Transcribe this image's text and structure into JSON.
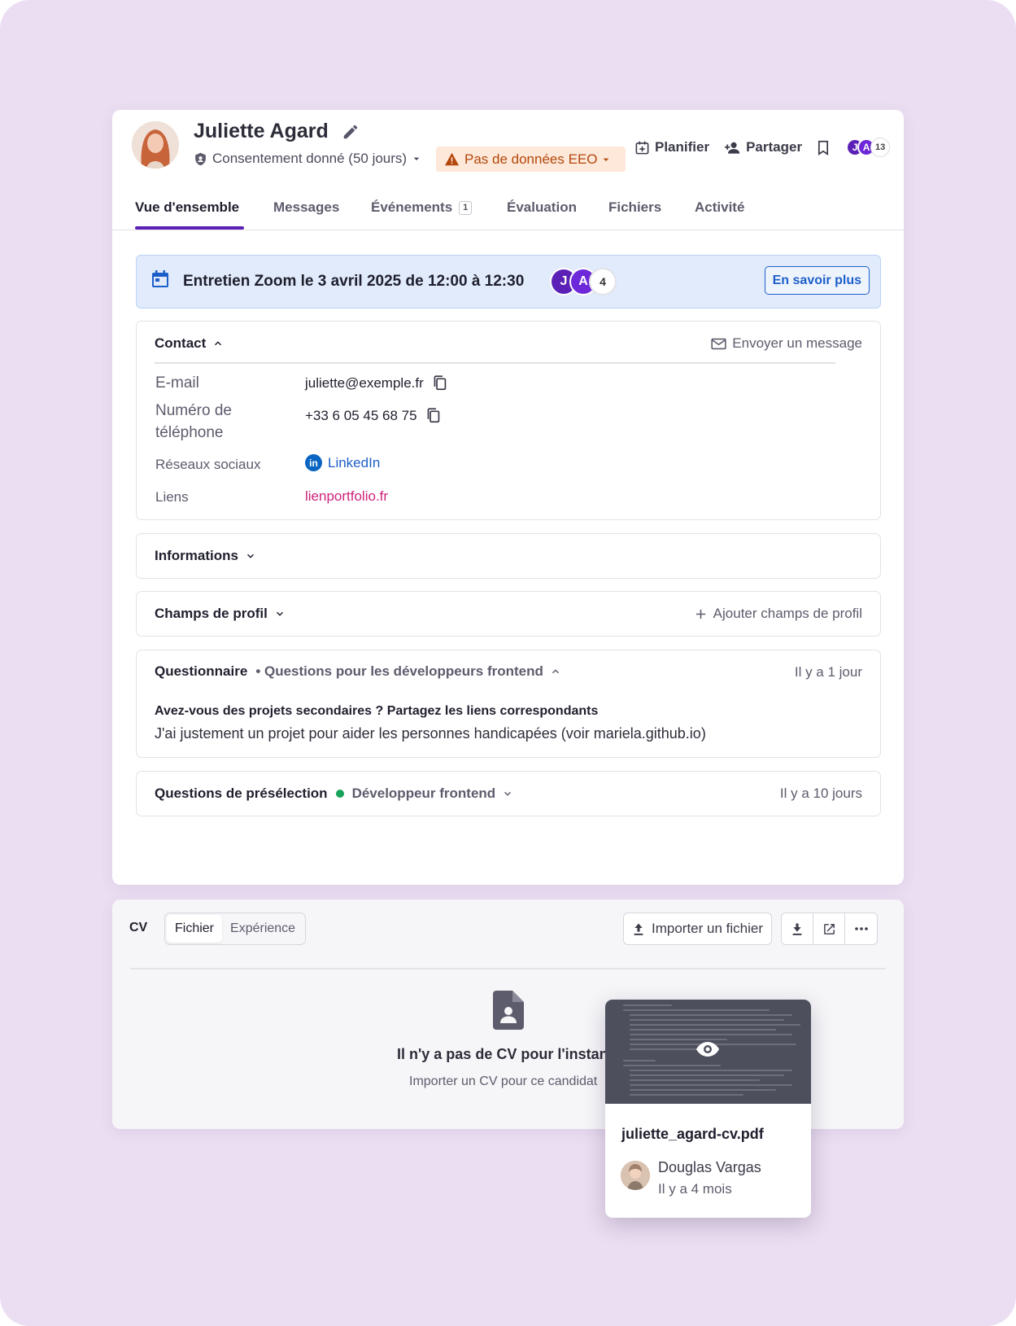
{
  "candidate": {
    "name": "Juliette Agard",
    "consent": "Consentement donné (50 jours)",
    "eeo": "Pas de données EEO"
  },
  "header_actions": {
    "schedule": "Planifier",
    "share": "Partager",
    "avatars": [
      "J",
      "A"
    ],
    "avatar_count": "13"
  },
  "tabs": [
    {
      "label": "Vue d'ensemble",
      "active": true
    },
    {
      "label": "Messages"
    },
    {
      "label": "Événements",
      "badge": "1"
    },
    {
      "label": "Évaluation"
    },
    {
      "label": "Fichiers"
    },
    {
      "label": "Activité"
    }
  ],
  "interview_banner": {
    "title": "Entretien Zoom le 3 avril 2025 de 12:00 à 12:30",
    "avatars": [
      "J",
      "A"
    ],
    "count": "4",
    "button": "En savoir plus"
  },
  "contact": {
    "title": "Contact",
    "send_message": "Envoyer un message",
    "email_label": "E-mail",
    "email": "juliette@exemple.fr",
    "phone_label_1": "Numéro de",
    "phone_label_2": "téléphone",
    "phone": "+33 6 05 45 68 75",
    "social_label": "Réseaux sociaux",
    "social": "LinkedIn",
    "links_label": "Liens",
    "link": "lienportfolio.fr"
  },
  "informations": {
    "title": "Informations"
  },
  "profile_fields": {
    "title": "Champs de profil",
    "add": "Ajouter champs de profil"
  },
  "questionnaire": {
    "title": "Questionnaire",
    "subtitle": "• Questions pour les développeurs frontend",
    "time": "Il y a 1 jour",
    "question": "Avez-vous des projets secondaires ? Partagez les liens correspondants",
    "answer": "J'ai justement un projet pour aider les personnes handicapées (voir mariela.github.io)"
  },
  "screening": {
    "title": "Questions de présélection",
    "job": "Développeur frontend",
    "time": "Il y a 10 jours"
  },
  "cv": {
    "label": "CV",
    "tab_file": "Fichier",
    "tab_experience": "Expérience",
    "import": "Importer un fichier",
    "empty_title": "Il n'y a pas de CV pour l'instant",
    "empty_sub": "Importer un CV pour ce candidat"
  },
  "preview": {
    "filename": "juliette_agard-cv.pdf",
    "user": "Douglas Vargas",
    "time": "Il y a 4 mois"
  },
  "colors": {
    "accent": "#5b21b6",
    "background": "#ebdef2",
    "link": "#1d5fc9",
    "pink_link": "#d0227a",
    "eeo_bg": "#fde8d9",
    "eeo_text": "#b3470c"
  }
}
